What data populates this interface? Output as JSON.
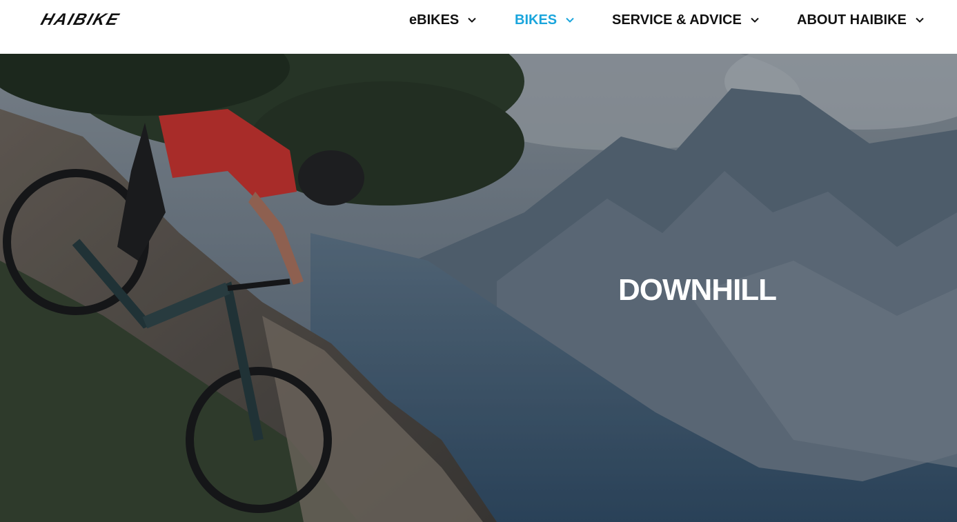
{
  "brand": {
    "logo_text": "HAIBIKE"
  },
  "nav": {
    "items": [
      {
        "label": "eBIKES",
        "active": false
      },
      {
        "label": "BIKES",
        "active": true
      },
      {
        "label": "SERVICE & ADVICE",
        "active": false
      },
      {
        "label": "ABOUT HAIBIKE",
        "active": false
      }
    ],
    "active_color": "#1aa5dc",
    "text_color": "#111111",
    "icon": "chevron-down-icon"
  },
  "hero": {
    "title": "DOWNHILL",
    "image": "mountain-biker-descending-rocky-slope"
  }
}
